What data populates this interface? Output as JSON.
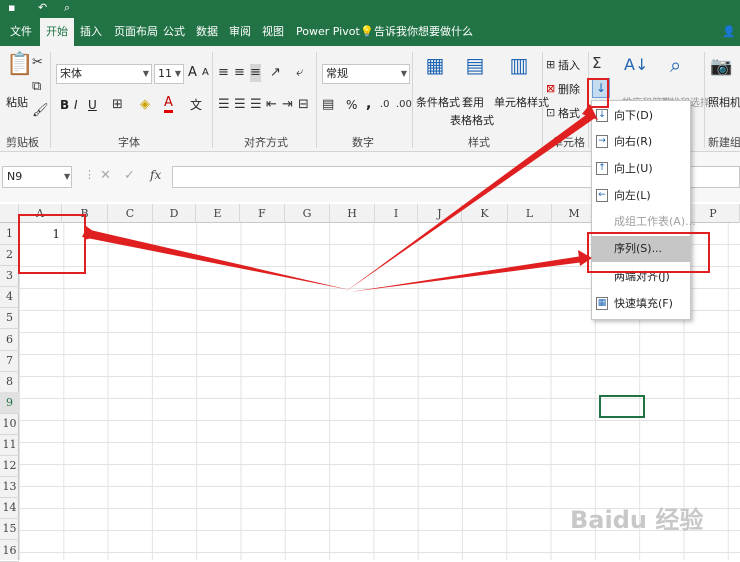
{
  "tabs": [
    "文件",
    "开始",
    "插入",
    "页面布局",
    "公式",
    "数据",
    "审阅",
    "视图",
    "Power Pivot"
  ],
  "active_tab": "开始",
  "tell_me": "告诉我你想要做什么",
  "ribbon": {
    "clipboard": {
      "paste": "粘贴",
      "label": "剪贴板"
    },
    "font": {
      "name": "宋体",
      "size": "11",
      "label": "字体",
      "bold": "B",
      "italic": "I",
      "underline": "U",
      "grow": "A",
      "shrink": "A",
      "color_letter": "A",
      "wen": "文"
    },
    "alignment": {
      "label": "对齐方式"
    },
    "number": {
      "format": "常规",
      "percent": "%",
      "comma": ",",
      "label": "数字"
    },
    "styles": {
      "conditional": "条件格式",
      "table1": "套用",
      "table2": "表格格式",
      "cell_styles": "单元格样式",
      "label": "样式"
    },
    "cells": {
      "insert": "插入",
      "delete": "删除",
      "format": "格式",
      "label": "单元格"
    },
    "editing": {
      "sort": "排序和筛选",
      "find": "查找和选择"
    },
    "new_group": {
      "camera": "照相机",
      "label": "新建组"
    }
  },
  "formula_bar": {
    "name_box": "N9",
    "cancel": "✕",
    "enter": "✓",
    "fx": "fx"
  },
  "columns": [
    "A",
    "B",
    "C",
    "D",
    "E",
    "F",
    "G",
    "H",
    "I",
    "J",
    "K",
    "L",
    "M",
    "N",
    "O",
    "P"
  ],
  "rows": [
    "1",
    "2",
    "3",
    "4",
    "5",
    "6",
    "7",
    "8",
    "9",
    "10",
    "11",
    "12",
    "13",
    "14",
    "15",
    "16"
  ],
  "selected_row": "9",
  "cells": {
    "A1": "1"
  },
  "fill_menu": {
    "items": [
      {
        "label": "向下(D)",
        "icon": "↓",
        "state": "normal"
      },
      {
        "label": "向右(R)",
        "icon": "→",
        "state": "normal"
      },
      {
        "label": "向上(U)",
        "icon": "↑",
        "state": "normal"
      },
      {
        "label": "向左(L)",
        "icon": "←",
        "state": "normal"
      },
      {
        "label": "成组工作表(A)...",
        "icon": "",
        "state": "disabled"
      },
      {
        "label": "序列(S)...",
        "icon": "",
        "state": "highlight"
      },
      {
        "label": "两端对齐(J)",
        "icon": "",
        "state": "normal"
      },
      {
        "label": "快速填充(F)",
        "icon": "▦",
        "state": "normal"
      }
    ]
  },
  "colors": {
    "excel_green": "#217346",
    "annotation_red": "#e02020"
  },
  "watermark": "Baidu 经验"
}
